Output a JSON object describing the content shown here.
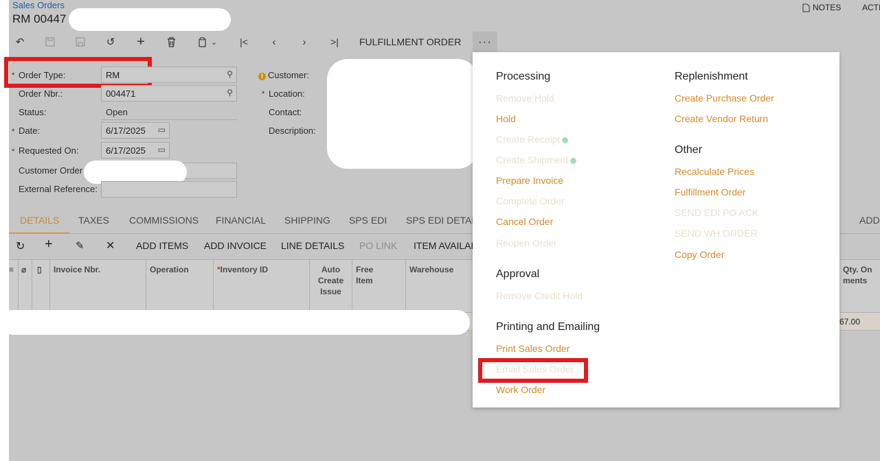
{
  "header": {
    "breadcrumb": "Sales Orders",
    "title": "RM 00447"
  },
  "top_right": {
    "notes": "NOTES",
    "actions": "ACTI"
  },
  "toolbar": {
    "fulfillment_order": "FULFILLMENT ORDER",
    "more": "···"
  },
  "form": {
    "order_type_label": "Order Type:",
    "order_type_value": "RM",
    "order_nbr_label": "Order Nbr.:",
    "order_nbr_value": "004471",
    "status_label": "Status:",
    "status_value": "Open",
    "date_label": "Date:",
    "date_value": "6/17/2025",
    "requested_on_label": "Requested On:",
    "requested_on_value": "6/17/2025",
    "customer_order_label": "Customer Order",
    "external_reference_label": "External Reference:",
    "customer_label": "Customer:",
    "location_label": "Location:",
    "contact_label": "Contact:",
    "description_label": "Description:",
    "required_marker": "*"
  },
  "tabs": [
    "DETAILS",
    "TAXES",
    "COMMISSIONS",
    "FINANCIAL",
    "SHIPPING",
    "SPS EDI",
    "SPS EDI DETAIL",
    "ADD"
  ],
  "subtoolbar": {
    "add_items": "ADD ITEMS",
    "add_invoice": "ADD INVOICE",
    "line_details": "LINE DETAILS",
    "po_link": "PO LINK",
    "item_availability": "ITEM AVAILAB"
  },
  "grid": {
    "columns": {
      "invoice_nbr": "Invoice Nbr.",
      "operation": "Operation",
      "inventory_id": "Inventory ID",
      "auto_create_issue": "Auto\nCreate\nIssue",
      "free_item": "Free\nItem",
      "warehouse": "Warehouse",
      "qty_on_shipments": "Qty. On\nments"
    },
    "row_value": "67.00"
  },
  "menu": {
    "processing": {
      "heading": "Processing",
      "items": [
        "Remove Hold",
        "Hold",
        "Create Receipt",
        "Create Shipment",
        "Prepare Invoice",
        "Complete Order",
        "Cancel Order",
        "Reopen Order"
      ]
    },
    "approval": {
      "heading": "Approval",
      "items": [
        "Remove Credit Hold"
      ]
    },
    "printing": {
      "heading": "Printing and Emailing",
      "items": [
        "Print Sales Order",
        "Email Sales Order",
        "Work Order"
      ]
    },
    "replenishment": {
      "heading": "Replenishment",
      "items": [
        "Create Purchase Order",
        "Create Vendor Return"
      ]
    },
    "other": {
      "heading": "Other",
      "items": [
        "Recalculate Prices",
        "Fulfillment Order",
        "SEND EDI PO ACK",
        "SEND WH ORDER",
        "Copy Order"
      ]
    }
  },
  "colors": {
    "accent": "#d4892a",
    "highlight_red": "#e11b1b",
    "link_blue": "#1a5ea8"
  }
}
